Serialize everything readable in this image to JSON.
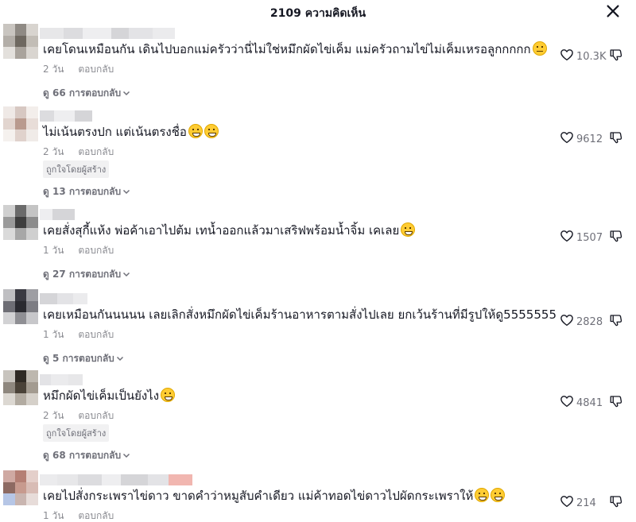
{
  "header": {
    "title": "2109 ความคิดเห็น",
    "close_icon": "close-icon"
  },
  "labels": {
    "reply": "ตอบกลับ",
    "creator_liked": "ถูกใจโดยผู้สร้าง"
  },
  "comments": [
    {
      "text": "เคยโดนเหมือนกัน เดินไปบอกแม่ครัวว่านี่ไม่ใช่หมึกผัดไข่เค็ม แม่ครัวถามไข่ไม่เค็มเหรอลูกกกกก",
      "emoji": [
        "expressionless-face"
      ],
      "time": "2 วัน",
      "likes": "10.3K",
      "creator_liked": false,
      "view_replies": "ดู 66 การตอบกลับ"
    },
    {
      "text": "ไม่เน้นตรงปก แต่เน้นตรงชื่อ",
      "emoji": [
        "grinning-face",
        "grinning-face"
      ],
      "time": "2 วัน",
      "likes": "9612",
      "creator_liked": true,
      "view_replies": "ดู 13 การตอบกลับ"
    },
    {
      "text": "เคยสั่งสุกี้แห้ง พ่อค้าเอาไปต้ม เทน้ำออกแล้วมาเสริฟพร้อมน้ำจิ้ม เคเลย",
      "emoji": [
        "laughing-face"
      ],
      "time": "1 วัน",
      "likes": "1507",
      "creator_liked": false,
      "view_replies": "ดู 27 การตอบกลับ"
    },
    {
      "text": "เคยเหมือนกันนนนน เลยเลิกสั่งหมึกผัดไข่เค็มร้านอาหารตามสั่งไปเลย ยกเว้นร้านที่มีรูปให้ดู5555555",
      "emoji": [],
      "time": "1 วัน",
      "likes": "2828",
      "creator_liked": false,
      "view_replies": "ดู 5 การตอบกลับ"
    },
    {
      "text": "หมึกผัดไข่เค็มเป็นยังไง",
      "emoji": [
        "grinning-sweat-face"
      ],
      "time": "2 วัน",
      "likes": "4841",
      "creator_liked": true,
      "view_replies": "ดู 68 การตอบกลับ"
    },
    {
      "text": "เคยไปสั่งกระเพราไข่ดาว ขาดคำว่าหมูสับคำเดียว แม่ค้าทอดไข่ดาวไปผัดกระเพราให้",
      "emoji": [
        "grinning-sweat-face",
        "grinning-sweat-face"
      ],
      "time": "1 วัน",
      "likes": "214",
      "creator_liked": false,
      "view_replies": ""
    }
  ],
  "colors": {
    "text": "#161823",
    "secondary": "#8a8b91",
    "badge_bg": "#f1f1f2",
    "avatar_pixels": [
      [
        "#c9c5c0",
        "#8f8a84",
        "#d8d4cf",
        "#b3aea8",
        "#6e6860",
        "#c2bdb6",
        "#e3e0dc",
        "#a9a39c",
        "#d9d5d0"
      ],
      [
        "#efe9e6",
        "#d7c8c2",
        "#f3eeeb",
        "#e2d5cf",
        "#b99a8e",
        "#e8ddd8",
        "#f5f1ee",
        "#e0d2cc",
        "#f0ebe8"
      ],
      [
        "#d0d0d0",
        "#6b6b6b",
        "#c4c4c4",
        "#9a9a9a",
        "#3e3e3e",
        "#8c8c8c",
        "#dadada",
        "#a7a7a7",
        "#cfcfcf"
      ],
      [
        "#bfbfc2",
        "#3a3a42",
        "#9e9ea3",
        "#6d6d74",
        "#2a2a30",
        "#7d7d83",
        "#d2d2d4",
        "#8f8f94",
        "#c7c7ca"
      ],
      [
        "#c8c4be",
        "#2f2a24",
        "#bdb7ae",
        "#8e877e",
        "#4a4238",
        "#a39b90",
        "#dcd8d2",
        "#b2aba1",
        "#d5d0c9"
      ],
      [
        "#cfa9a2",
        "#b57f74",
        "#e4cfca",
        "#8d6a62",
        "#c79a8e",
        "#d8bcb5",
        "#b6c6e6",
        "#c9b5b0",
        "#e7dcd9"
      ]
    ]
  }
}
